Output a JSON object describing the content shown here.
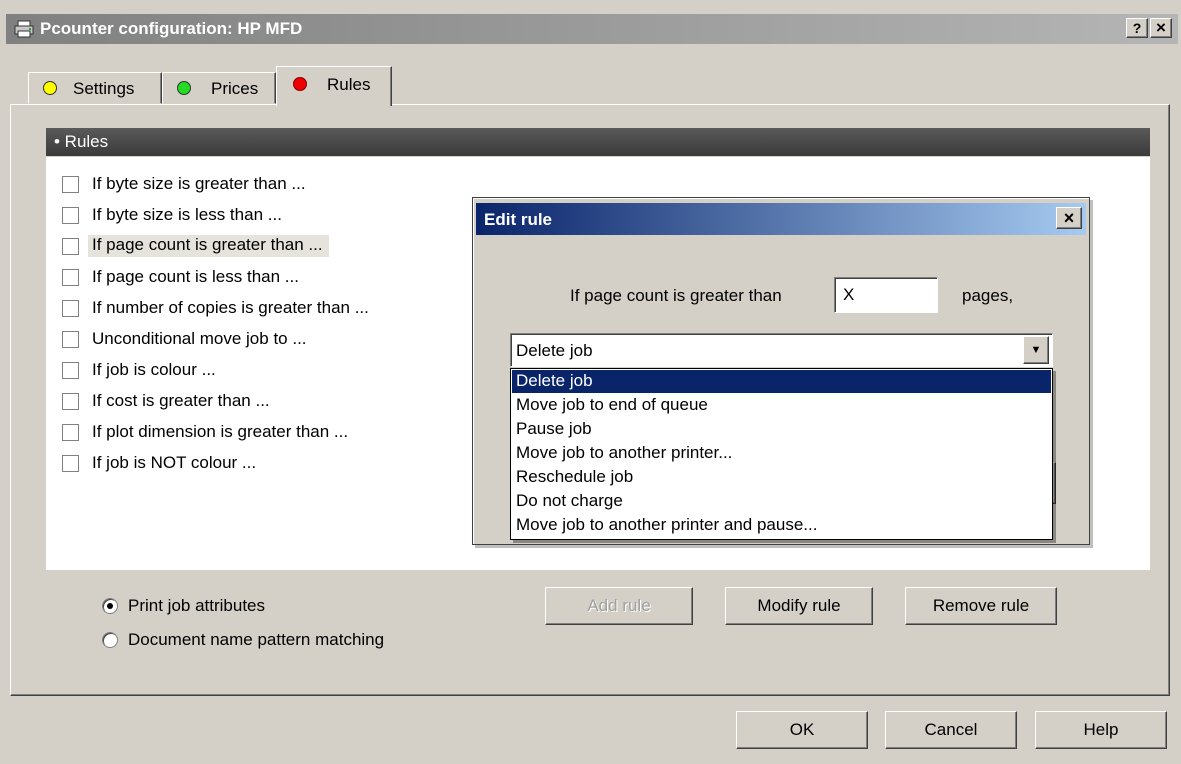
{
  "window": {
    "title": "Pcounter configuration: HP MFD",
    "help_btn": "?",
    "close_btn": "×"
  },
  "tabs": [
    {
      "label": "Settings",
      "dot_color": "#ffff00"
    },
    {
      "label": "Prices",
      "dot_color": "#22dd22"
    },
    {
      "label": "Rules",
      "dot_color": "#ee0000",
      "active": true
    }
  ],
  "rules_panel": {
    "header": "• Rules",
    "items": [
      {
        "label": "If byte size is greater than ..."
      },
      {
        "label": "If byte size is less than ..."
      },
      {
        "label": "If page count is greater than ...",
        "selected": true
      },
      {
        "label": "If page count is less than ..."
      },
      {
        "label": "If number of copies is greater than ..."
      },
      {
        "label": "Unconditional move job to ..."
      },
      {
        "label": "If job is colour ..."
      },
      {
        "label": "If cost is greater than ..."
      },
      {
        "label": "If plot dimension is greater than ..."
      },
      {
        "label": "If job is NOT colour ..."
      }
    ]
  },
  "mode": {
    "option1": "Print job attributes",
    "option2": "Document name pattern matching",
    "selected": "Print job attributes"
  },
  "rule_buttons": {
    "add": "Add rule",
    "modify": "Modify rule",
    "remove": "Remove rule"
  },
  "footer": {
    "ok": "OK",
    "cancel": "Cancel",
    "help": "Help"
  },
  "edit_dialog": {
    "title": "Edit rule",
    "close": "×",
    "condition_prefix": "If page count is greater than",
    "condition_value": "X",
    "condition_suffix": "pages,",
    "action_selected": "Delete job",
    "dropdown_arrow": "▼",
    "action_options": [
      "Delete job",
      "Move job to end of queue",
      "Pause job",
      "Move job to another printer...",
      "Reschedule job",
      "Do not charge",
      "Move job to another printer and pause..."
    ]
  }
}
